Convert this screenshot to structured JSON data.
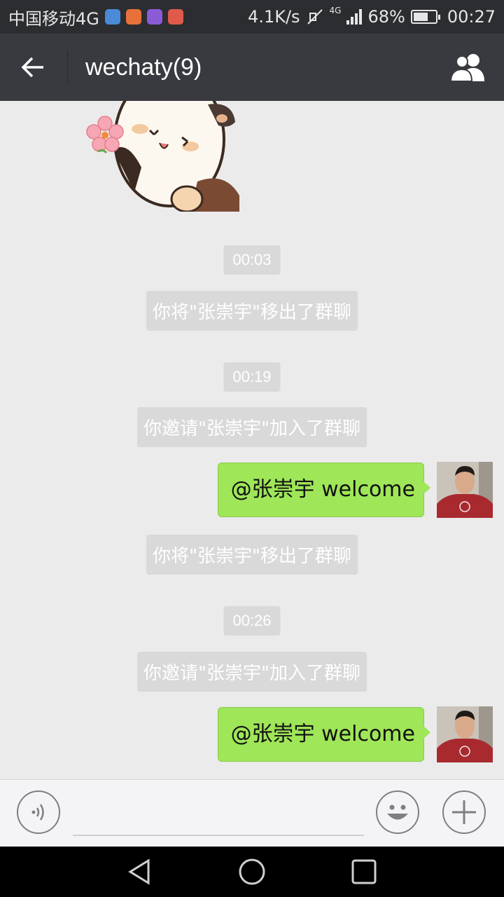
{
  "status_bar": {
    "carrier": "中国移动4G",
    "net_speed": "4.1K/s",
    "network_type": "4G",
    "battery": "68%",
    "battery_level": 0.68,
    "time": "00:27"
  },
  "header": {
    "title": "wechaty(9)"
  },
  "messages": [
    {
      "type": "time",
      "text": "00:03"
    },
    {
      "type": "system",
      "text": "你将\"张崇宇\"移出了群聊"
    },
    {
      "type": "time",
      "text": "00:19"
    },
    {
      "type": "system",
      "text": "你邀请\"张崇宇\"加入了群聊"
    },
    {
      "type": "outgoing",
      "text": "@张崇宇 welcome"
    },
    {
      "type": "system",
      "text": "你将\"张崇宇\"移出了群聊"
    },
    {
      "type": "time",
      "text": "00:26"
    },
    {
      "type": "system",
      "text": "你邀请\"张崇宇\"加入了群聊"
    },
    {
      "type": "outgoing",
      "text": "@张崇宇 welcome"
    }
  ],
  "input_bar": {
    "voice_icon": "voice-icon",
    "emoji_icon": "emoji-icon",
    "plus_icon": "plus-icon"
  },
  "colors": {
    "bubble": "#9fe658",
    "titlebar": "#393a3f",
    "chat_bg": "#ebebeb"
  }
}
